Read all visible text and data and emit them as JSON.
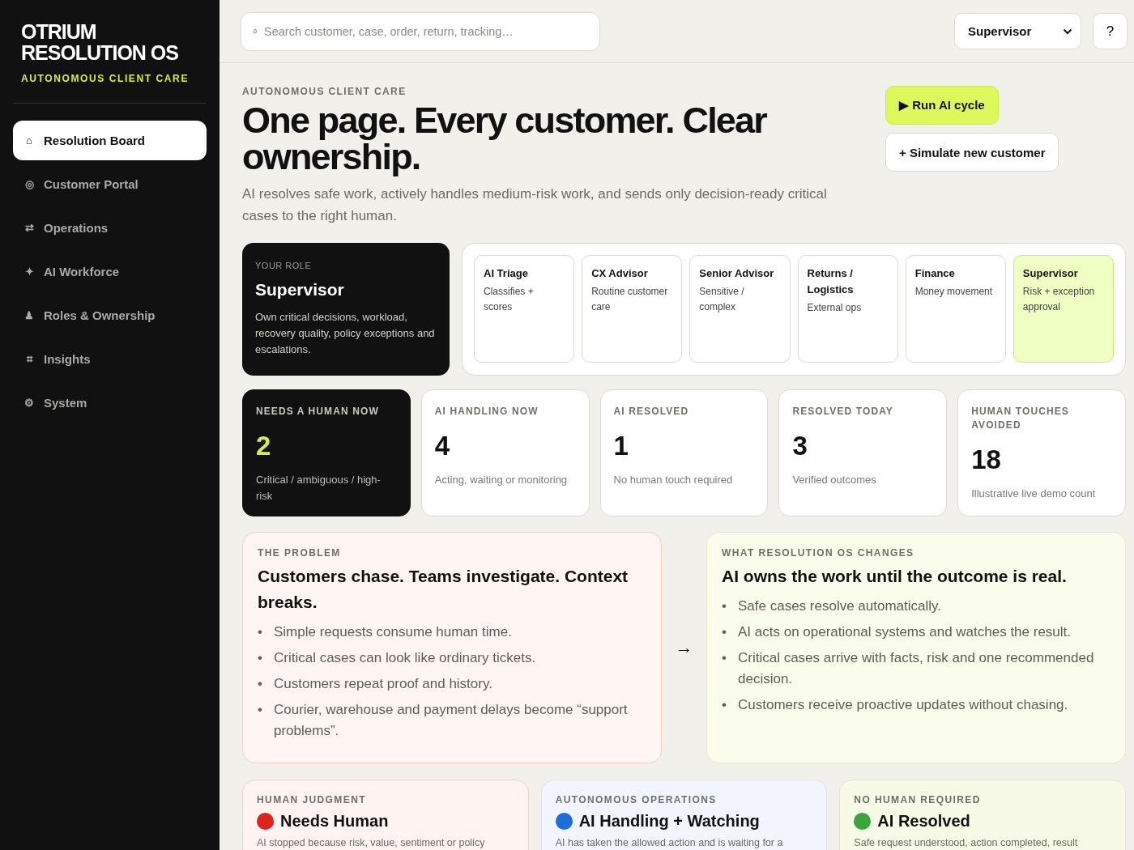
{
  "brand": {
    "title": "OTRIUM RESOLUTION OS",
    "tagline": "AUTONOMOUS CLIENT CARE"
  },
  "nav": [
    {
      "icon": "⌂",
      "label": "Resolution Board",
      "selected": true
    },
    {
      "icon": "◎",
      "label": "Customer Portal",
      "selected": false
    },
    {
      "icon": "⇄",
      "label": "Operations",
      "selected": false
    },
    {
      "icon": "✦",
      "label": "AI Workforce",
      "selected": false
    },
    {
      "icon": "♟",
      "label": "Roles & Ownership",
      "selected": false
    },
    {
      "icon": "⌗",
      "label": "Insights",
      "selected": false
    },
    {
      "icon": "⚙",
      "label": "System",
      "selected": false
    }
  ],
  "topbar": {
    "search": {
      "icon": "⌕",
      "placeholder": "Search customer, case, order, return, tracking…"
    },
    "role_select": {
      "value": "Supervisor"
    },
    "help": "?"
  },
  "hero": {
    "eyebrow": "AUTONOMOUS CLIENT CARE",
    "title": "One page. Every customer. Clear ownership.",
    "description": "AI resolves safe work, actively handles medium-risk work, and sends only decision-ready critical cases to the right human.",
    "actions": [
      {
        "label": "▶ Run AI cycle",
        "kind": "primary"
      },
      {
        "label": "+ Simulate new customer",
        "kind": "secondary"
      }
    ]
  },
  "your_role": {
    "eyebrow": "YOUR ROLE",
    "title": "Supervisor",
    "description": "Own critical decisions, workload, recovery quality, policy exceptions and escalations."
  },
  "roles": [
    {
      "name": "AI Triage",
      "description": "Classifies + scores",
      "selected": false
    },
    {
      "name": "CX Advisor",
      "description": "Routine customer care",
      "selected": false
    },
    {
      "name": "Senior Advisor",
      "description": "Sensitive / complex",
      "selected": false
    },
    {
      "name": "Returns / Logistics",
      "description": "External ops",
      "selected": false
    },
    {
      "name": "Finance",
      "description": "Money movement",
      "selected": false
    },
    {
      "name": "Supervisor",
      "description": "Risk + exception approval",
      "selected": true
    }
  ],
  "stats": [
    {
      "label": "NEEDS A HUMAN NOW",
      "value": "2",
      "note": "Critical / ambiguous / high-risk",
      "emphasis": true
    },
    {
      "label": "AI HANDLING NOW",
      "value": "4",
      "note": "Acting, waiting or monitoring",
      "emphasis": false
    },
    {
      "label": "AI RESOLVED",
      "value": "1",
      "note": "No human touch required",
      "emphasis": false
    },
    {
      "label": "RESOLVED TODAY",
      "value": "3",
      "note": "Verified outcomes",
      "emphasis": false
    },
    {
      "label": "HUMAN TOUCHES AVOIDED",
      "value": "18",
      "note": "Illustrative live demo count",
      "emphasis": false
    }
  ],
  "comparison": {
    "problem": {
      "eyebrow": "THE PROBLEM",
      "title": "Customers chase. Teams investigate. Context breaks.",
      "points": [
        "Simple requests consume human time.",
        "Critical cases can look like ordinary tickets.",
        "Customers repeat proof and history.",
        "Courier, warehouse and payment delays become “support problems”."
      ]
    },
    "bullet": "•",
    "arrow": "→",
    "change": {
      "eyebrow": "WHAT RESOLUTION OS CHANGES",
      "title": "AI owns the work until the outcome is real.",
      "points": [
        "Safe cases resolve automatically.",
        "AI acts on operational systems and watches the result.",
        "Critical cases arrive with facts, risk and one recommended decision.",
        "Customers receive proactive updates without chasing."
      ]
    }
  },
  "lanes": [
    {
      "eyebrow": "HUMAN JUDGMENT",
      "title": "Needs Human",
      "color": "#e0241b",
      "description": "AI stopped because risk, value, sentiment or policy"
    },
    {
      "eyebrow": "AUTONOMOUS OPERATIONS",
      "title": "AI Handling + Watching",
      "color": "#1e6fd9",
      "description": "AI has taken the allowed action and is waiting for a"
    },
    {
      "eyebrow": "NO HUMAN REQUIRED",
      "title": "AI Resolved",
      "color": "#3aa53a",
      "description": "Safe request understood, action completed, result"
    }
  ]
}
